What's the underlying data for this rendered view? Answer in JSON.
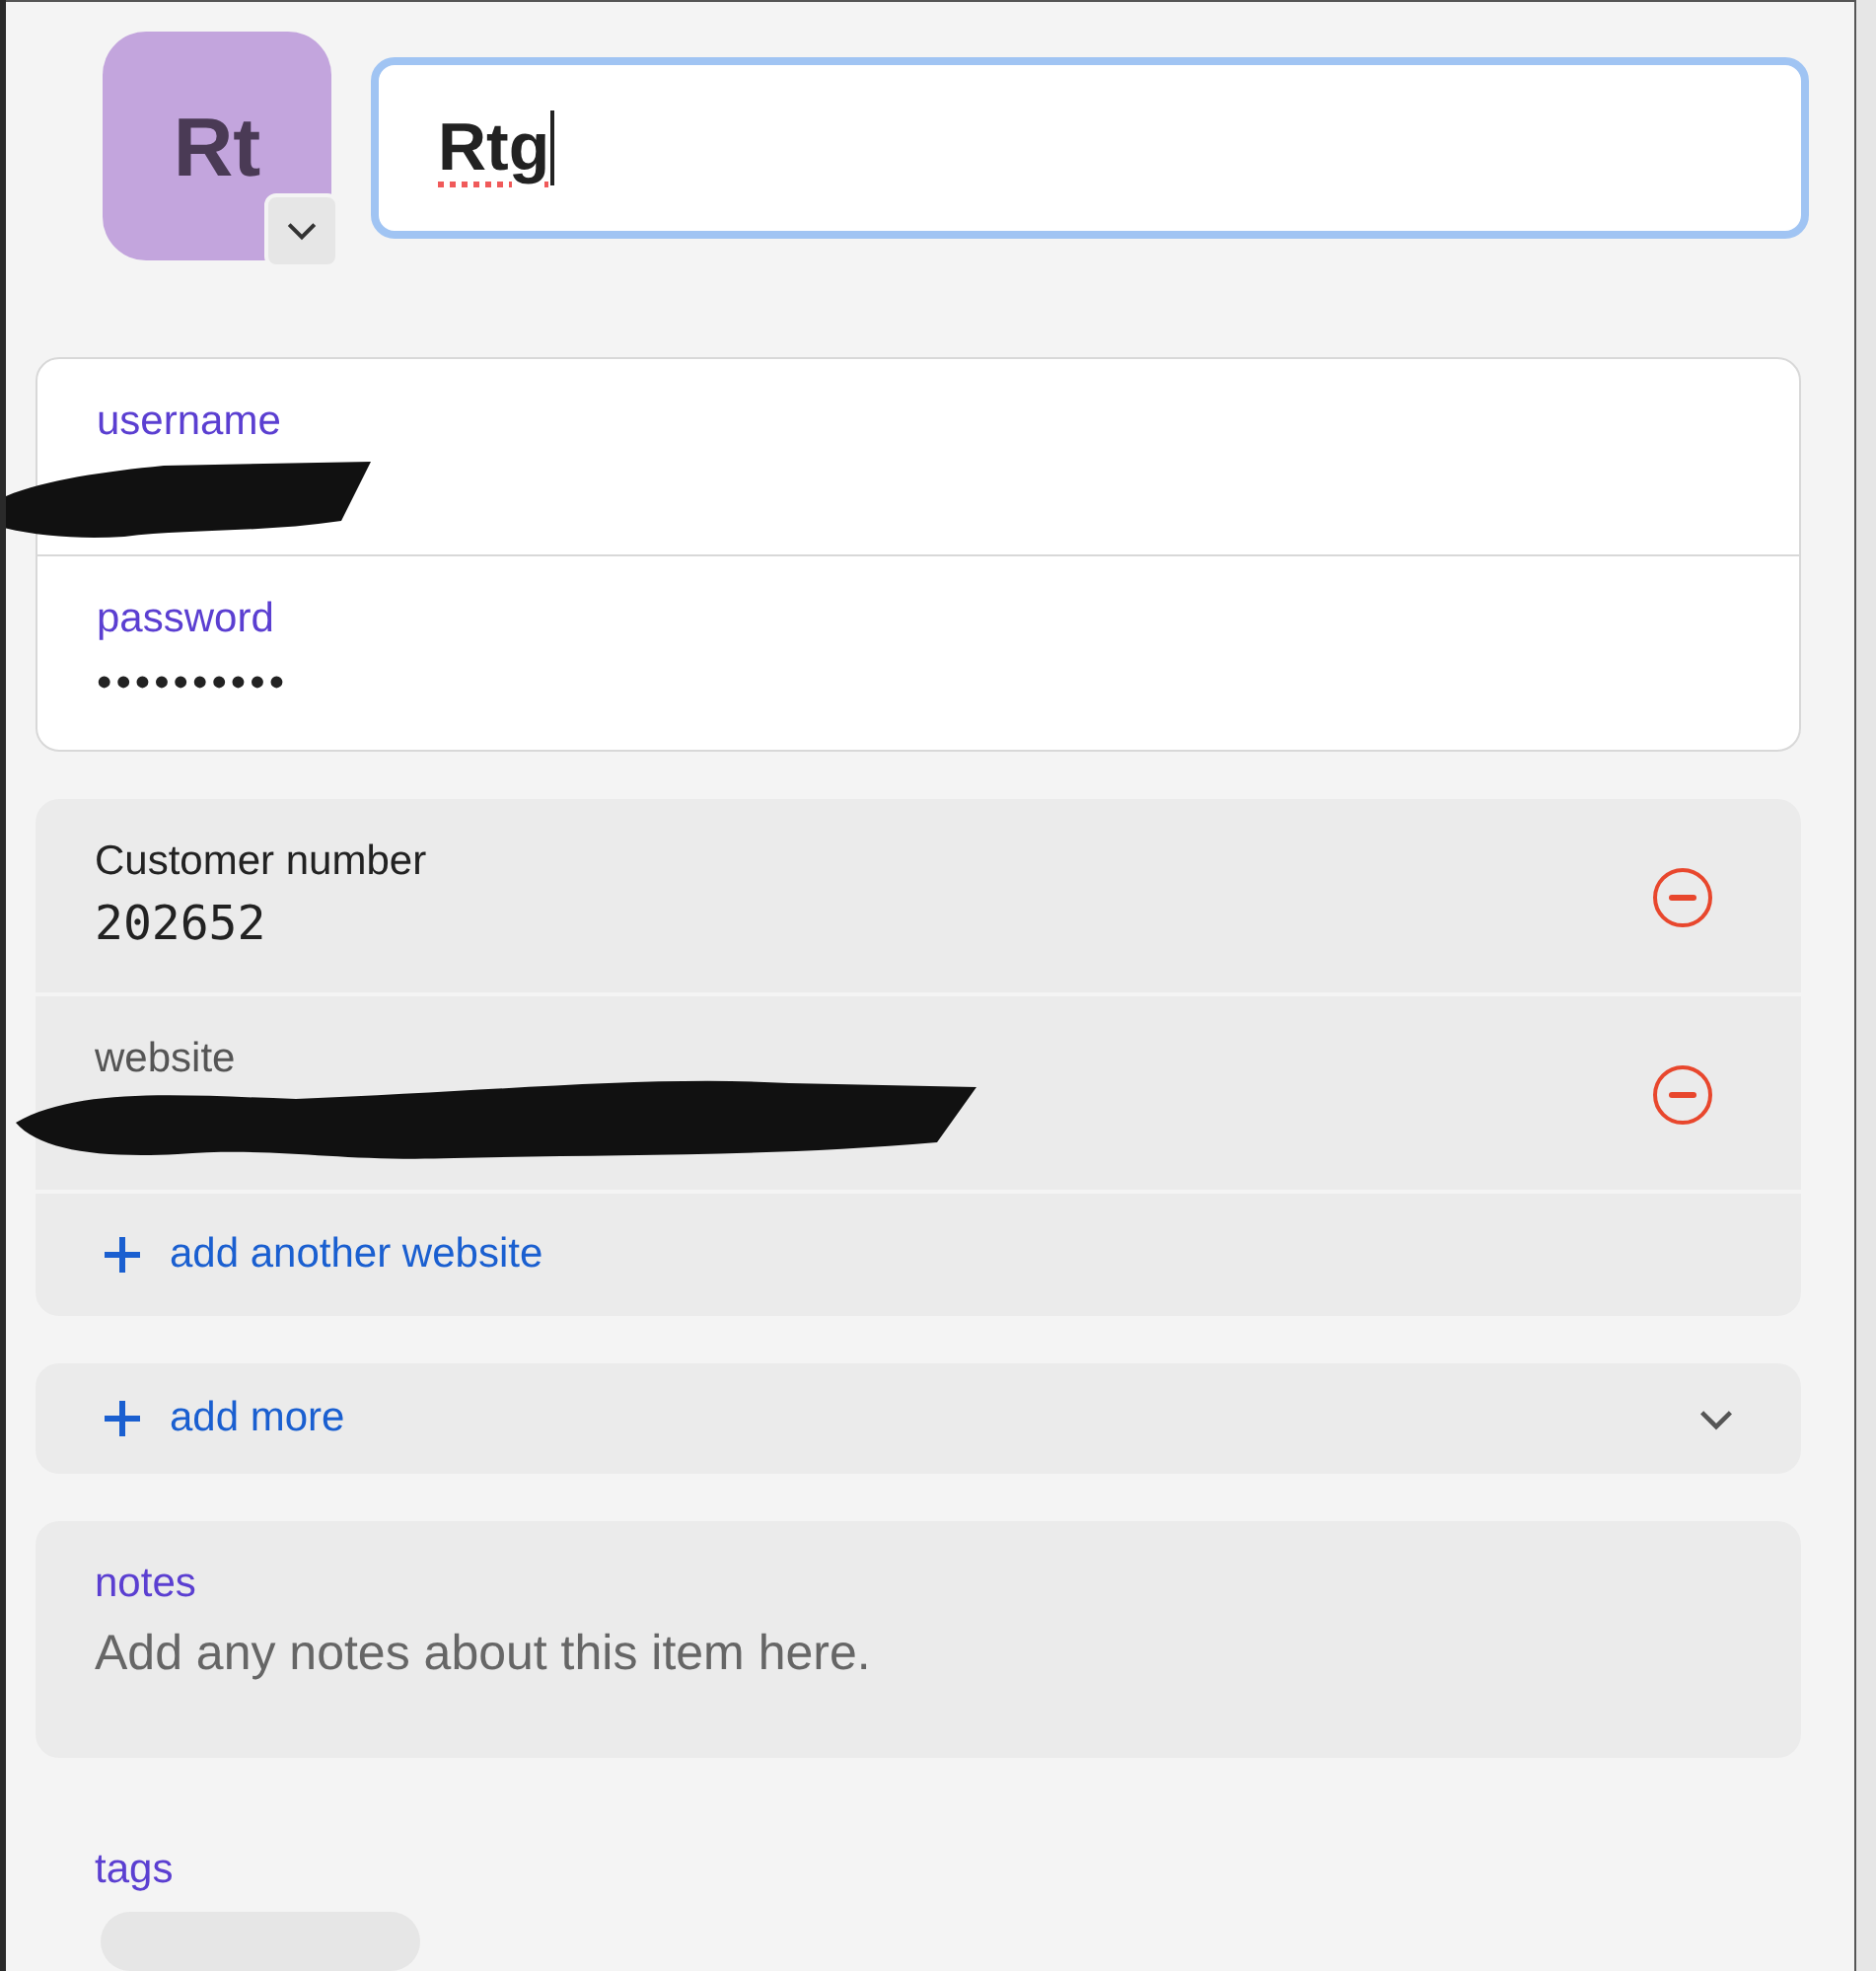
{
  "avatar": {
    "initials": "Rt"
  },
  "title_field": {
    "value": "Rtg",
    "misspelled": true
  },
  "login_fields": [
    {
      "label": "username",
      "redacted": true
    },
    {
      "label": "password",
      "value": "••••••••••",
      "redacted": false
    }
  ],
  "custom_fields": [
    {
      "kind": "text",
      "label": "Customer number",
      "value": "202652",
      "redacted": false
    },
    {
      "kind": "url",
      "label": "website",
      "redacted": true
    }
  ],
  "add_website": {
    "label": "add another website"
  },
  "add_more": {
    "label": "add more",
    "expanded": false
  },
  "notes": {
    "label": "notes",
    "placeholder": "Add any notes about this item here."
  },
  "tags": {
    "label": "tags"
  }
}
